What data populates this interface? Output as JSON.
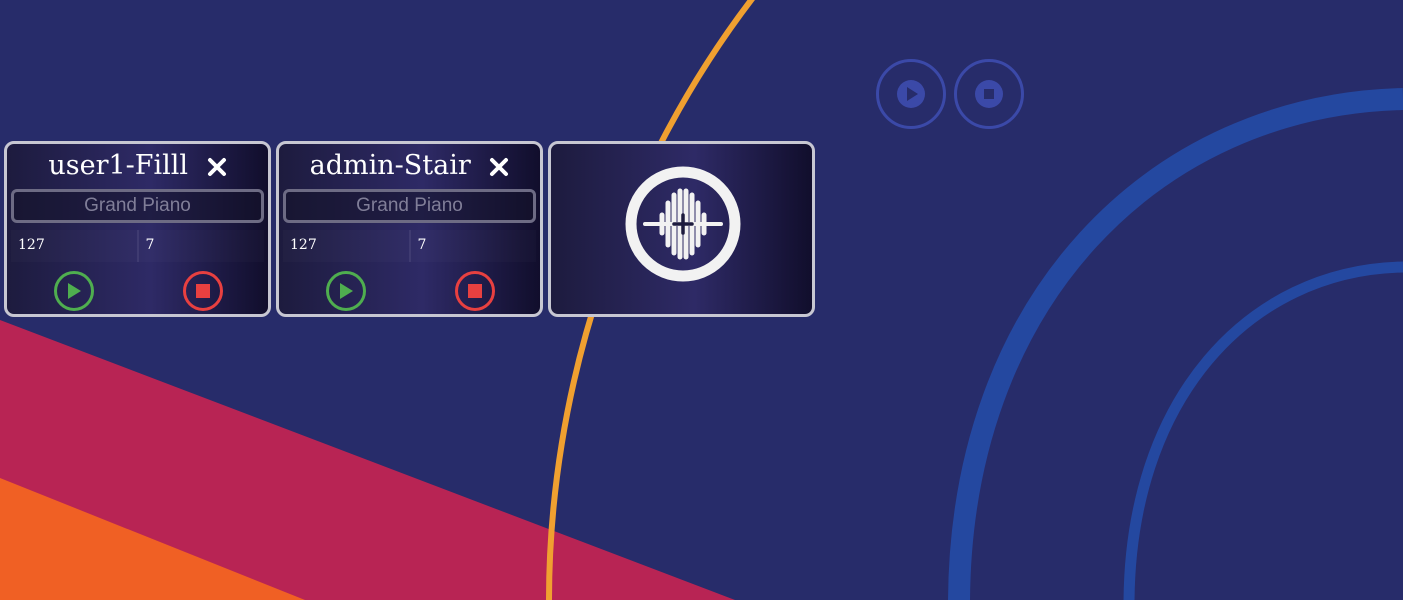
{
  "colors": {
    "background": "#272c6a",
    "stripe_magenta": "#b82454",
    "stripe_orange": "#f06024",
    "arc_yellow": "#f0a030",
    "arc_blue": "#2448a0",
    "play_green": "#4fae4f",
    "stop_red": "#e84040",
    "control_blue": "#3b49a8"
  },
  "global_controls": {
    "play_icon": "play-circle-icon",
    "stop_icon": "stop-circle-icon"
  },
  "tracks": [
    {
      "title": "user1-Filll",
      "instrument": "Grand Piano",
      "velocity": "127",
      "channel": "7"
    },
    {
      "title": "admin-Stair",
      "instrument": "Grand Piano",
      "velocity": "127",
      "channel": "7"
    }
  ],
  "add_track": {
    "icon": "add-waveform-icon"
  }
}
